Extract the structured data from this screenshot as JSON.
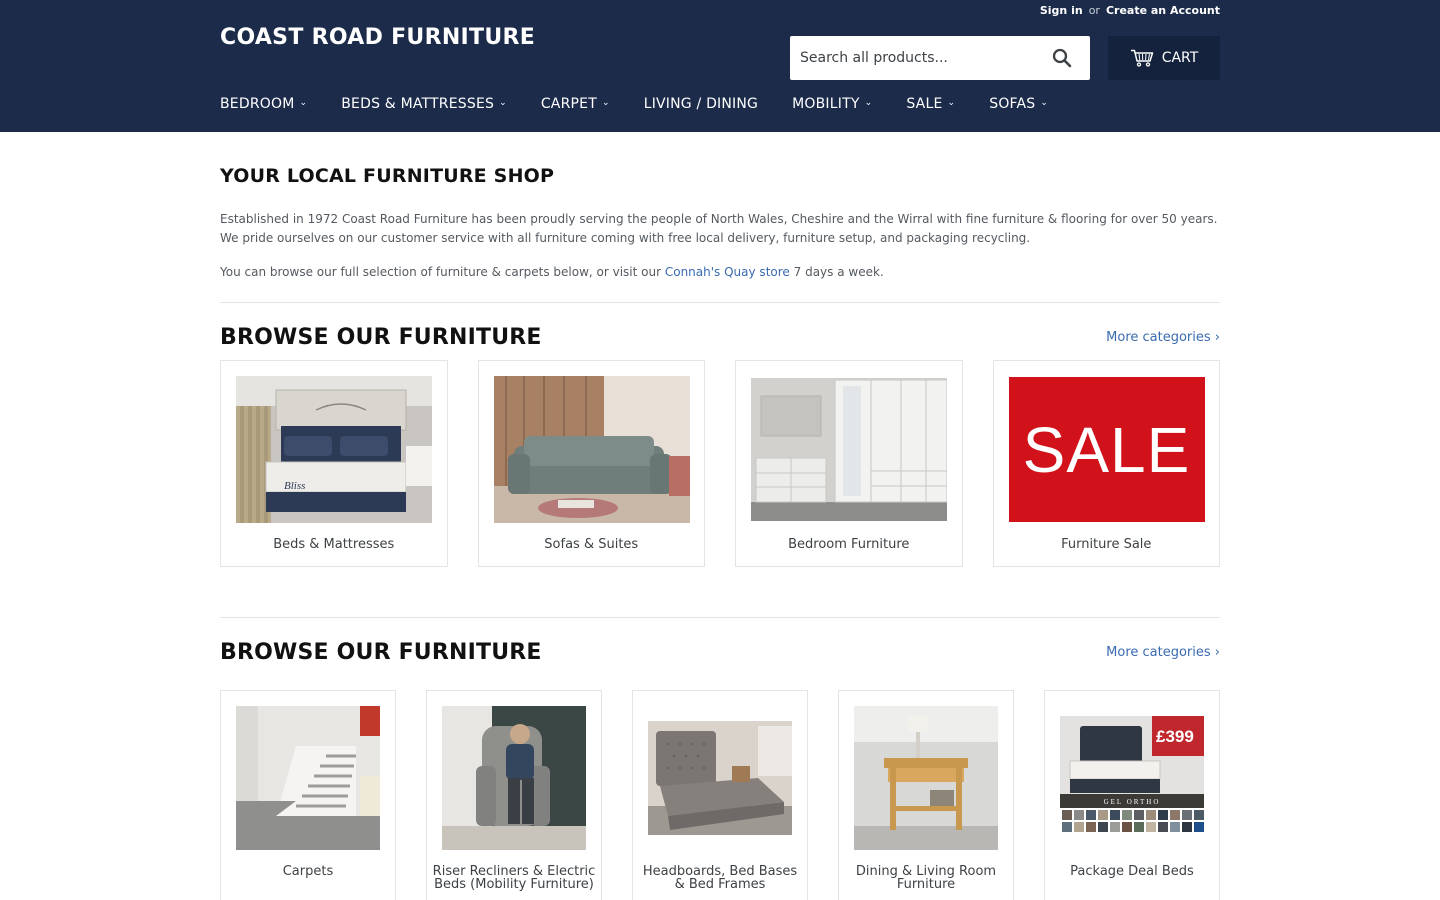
{
  "header": {
    "sign_in": "Sign in",
    "or": "or",
    "create_account": "Create an Account",
    "logo": "COAST ROAD FURNITURE",
    "search_placeholder": "Search all products...",
    "cart_label": "CART",
    "icons": {
      "search": "search-icon",
      "cart": "cart-icon",
      "dropdown": "chevron-down-icon"
    }
  },
  "nav": [
    {
      "label": "BEDROOM",
      "dropdown": true
    },
    {
      "label": "BEDS & MATTRESSES",
      "dropdown": true
    },
    {
      "label": "CARPET",
      "dropdown": true
    },
    {
      "label": "LIVING / DINING",
      "dropdown": false
    },
    {
      "label": "MOBILITY",
      "dropdown": true
    },
    {
      "label": "SALE",
      "dropdown": true
    },
    {
      "label": "SOFAS",
      "dropdown": true
    }
  ],
  "intro": {
    "title": "YOUR LOCAL FURNITURE SHOP",
    "line1": "Established in 1972 Coast Road Furniture has been proudly serving the people of North Wales, Cheshire and the Wirral with fine furniture & flooring for over 50 years.",
    "line2": "We pride ourselves on our customer service with all furniture coming with free local delivery, furniture setup, and packaging recycling.",
    "browse_before": "You can browse our full selection of furniture & carpets below, or visit our",
    "store_link": "Connah's Quay store",
    "browse_after": "7 days a week."
  },
  "section1": {
    "title": "BROWSE OUR FURNITURE",
    "more": "More categories ›",
    "items": [
      {
        "label": "Beds & Mattresses"
      },
      {
        "label": "Sofas & Suites"
      },
      {
        "label": "Bedroom Furniture"
      },
      {
        "label": "Furniture Sale",
        "image_text": "SALE"
      }
    ]
  },
  "section2": {
    "title": "BROWSE OUR FURNITURE",
    "more": "More categories ›",
    "items": [
      {
        "label": "Carpets"
      },
      {
        "label": "Riser Recliners & Electric Beds (Mobility Furniture)"
      },
      {
        "label": "Headboards, Bed Bases & Bed Frames"
      },
      {
        "label": "Dining & Living Room Furniture"
      },
      {
        "label": "Package Deal Beds",
        "image_text_price": "£399",
        "image_text_banner": "GEL ORTHO"
      }
    ]
  },
  "colors": {
    "header_bg": "#1c2b4a",
    "cart_bg": "#15223d",
    "link": "#3a6bb0",
    "sale_red": "#d2121b"
  }
}
